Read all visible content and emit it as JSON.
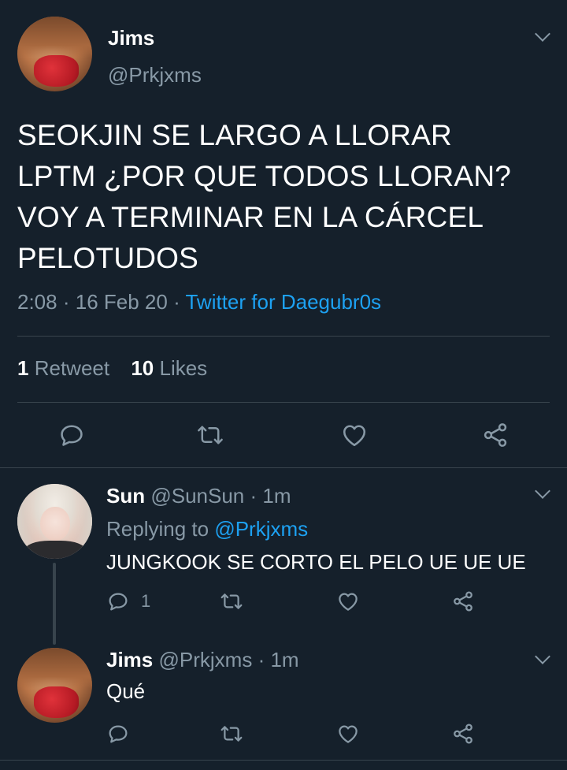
{
  "main_tweet": {
    "name": "Jims",
    "handle": "@Prkjxms",
    "text": "SEOKJIN SE LARGO A LLORAR\nLPTM ¿POR QUE TODOS LLORAN?\nVOY A TERMINAR EN LA CÁRCEL\nPELOTUDOS",
    "time": "2:08",
    "date": "16 Feb 20",
    "source": "Twitter for Daegubr0s",
    "retweets_count": "1",
    "retweets_label": "Retweet",
    "likes_count": "10",
    "likes_label": "Likes"
  },
  "replies": [
    {
      "name": "Sun",
      "handle": "@SunSun",
      "age": "1m",
      "replying_prefix": "Replying to",
      "replying_to": "@Prkjxms",
      "text": "JUNGKOOK SE CORTO EL PELO UE UE UE",
      "reply_count": "1"
    },
    {
      "name": "Jims",
      "handle": "@Prkjxms",
      "age": "1m",
      "text": "Qué"
    }
  ],
  "icons": [
    "chevron-down-icon",
    "reply-icon",
    "retweet-icon",
    "like-icon",
    "share-icon"
  ],
  "colors": {
    "background": "#15202b",
    "text": "#ffffff",
    "secondary": "#8899a6",
    "link": "#1da1f2",
    "divider": "#38444d"
  }
}
